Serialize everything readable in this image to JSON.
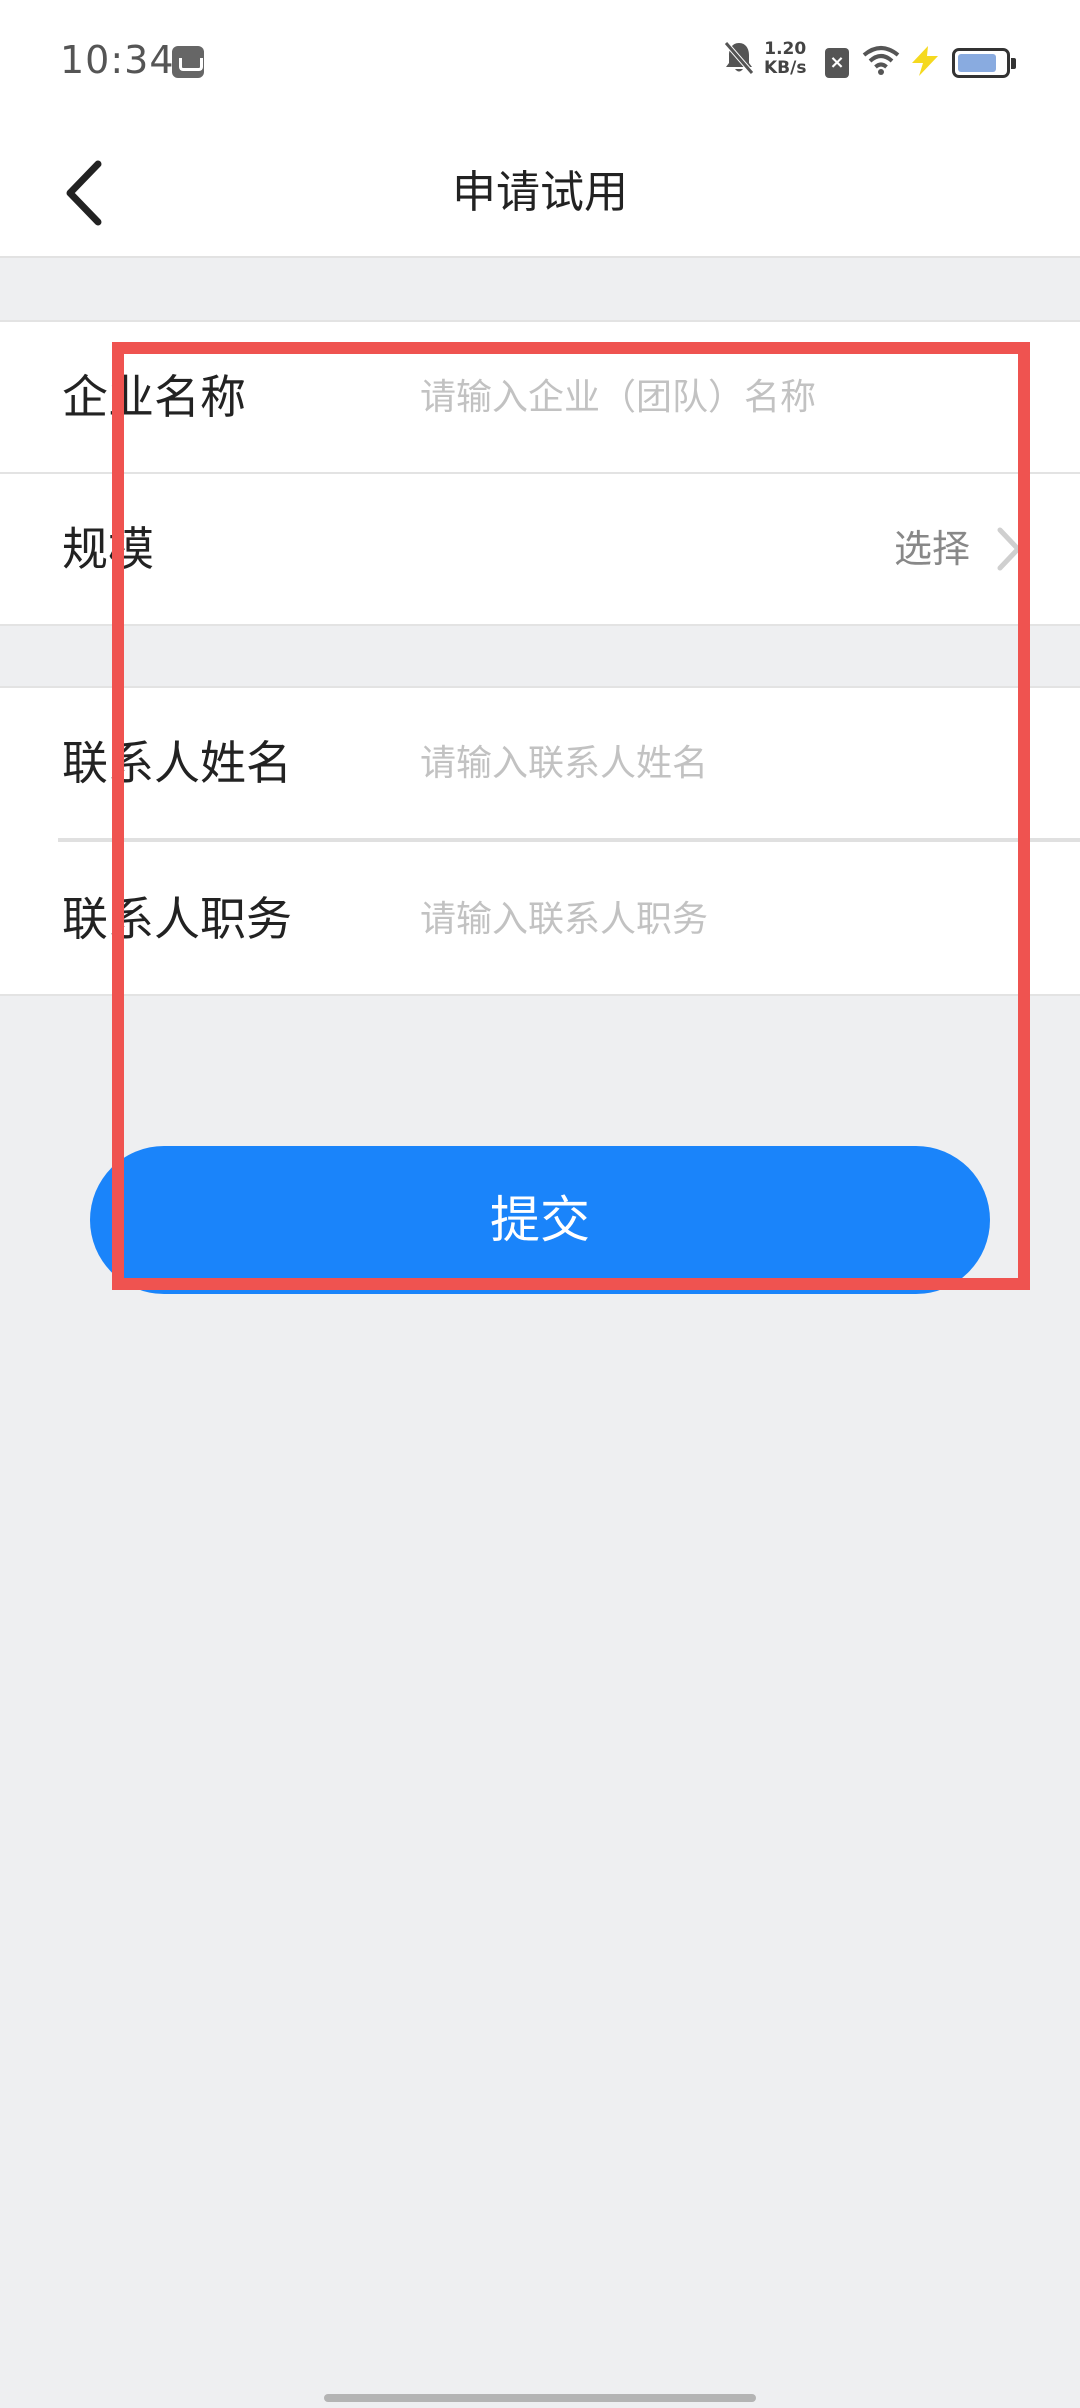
{
  "status_bar": {
    "time": "10:34",
    "network_speed_value": "1.20",
    "network_speed_unit": "KB/s",
    "icons": [
      "app-notification-icon",
      "bell-off-icon",
      "sim-disabled-icon",
      "wifi-icon",
      "charging-bolt-icon",
      "battery-icon"
    ],
    "charging_color": "#f5d91f"
  },
  "header": {
    "title": "申请试用",
    "back_icon": "chevron-left-icon"
  },
  "form": {
    "company_name": {
      "label": "企业名称",
      "placeholder": "请输入企业（团队）名称",
      "value": ""
    },
    "scale": {
      "label": "规模",
      "value": "选择",
      "icon": "chevron-right-icon"
    },
    "contact_name": {
      "label": "联系人姓名",
      "placeholder": "请输入联系人姓名",
      "value": ""
    },
    "contact_title": {
      "label": "联系人职务",
      "placeholder": "请输入联系人职务",
      "value": ""
    }
  },
  "submit": {
    "label": "提交"
  },
  "colors": {
    "primary": "#1a84fa",
    "highlight": "#ef5350",
    "background": "#eeeff1",
    "placeholder": "#c2c2c2"
  }
}
